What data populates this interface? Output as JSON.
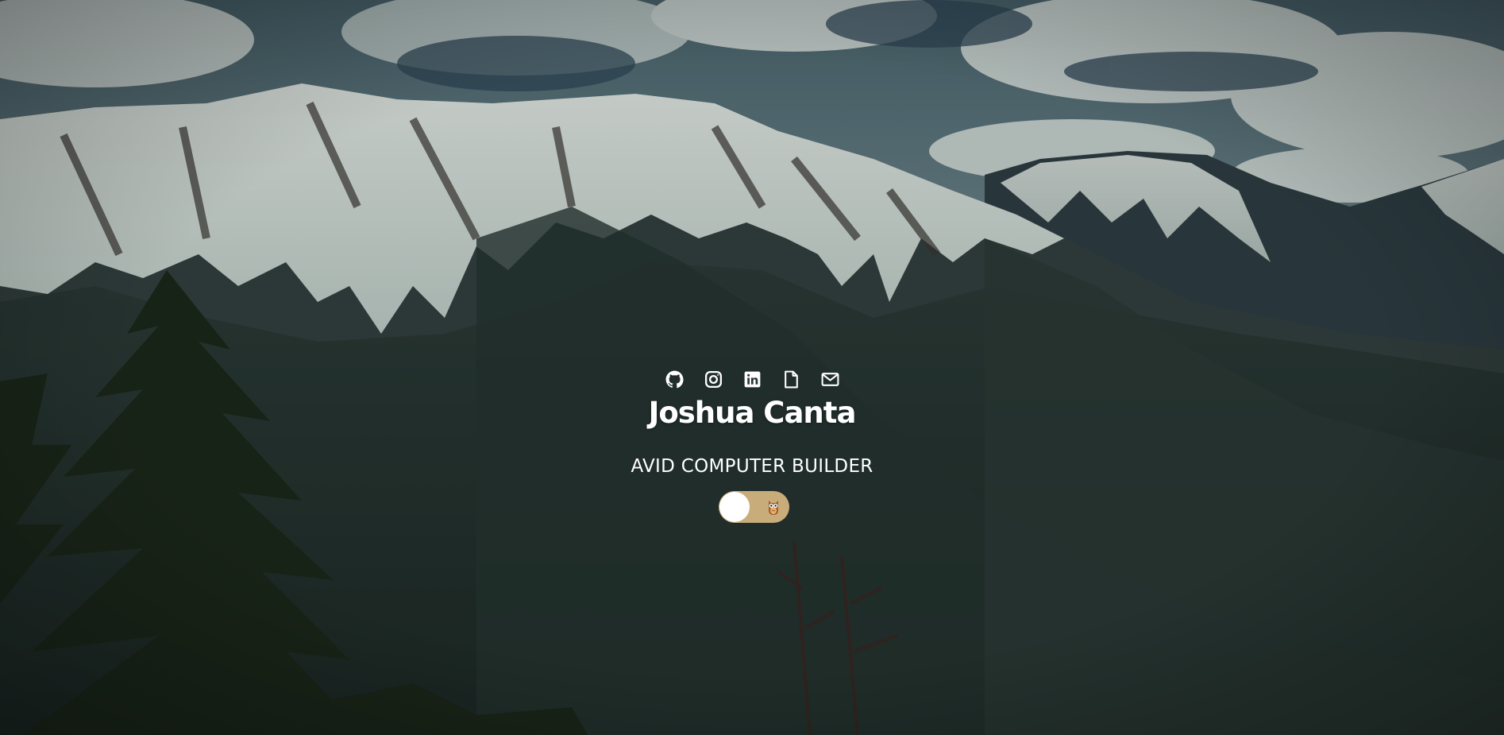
{
  "profile": {
    "name": "Joshua Canta",
    "tagline": "AVID COMPUTER BUILDER"
  },
  "social_links": [
    {
      "icon": "github-icon"
    },
    {
      "icon": "instagram-icon"
    },
    {
      "icon": "linkedin-icon"
    },
    {
      "icon": "document-icon"
    },
    {
      "icon": "email-icon"
    }
  ],
  "theme_toggle": {
    "state": "off",
    "icon": "owl-icon",
    "track_color": "#c8ad7a",
    "knob_color": "#ffffff"
  },
  "background": {
    "subject": "snow-capped mountains under cloudy sky with pine trees"
  }
}
